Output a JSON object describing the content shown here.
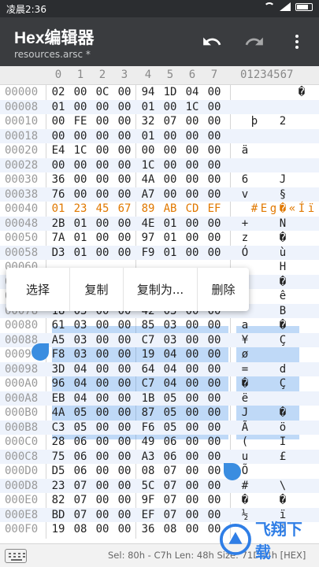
{
  "status_bar": {
    "time": "凌晨2:36"
  },
  "app_bar": {
    "title": "Hex编辑器",
    "subtitle": "resources.arsc *",
    "icons": [
      "undo-icon",
      "redo-icon",
      "more-vert-icon"
    ]
  },
  "header": {
    "columns": [
      "0",
      "1",
      "2",
      "3",
      "4",
      "5",
      "6",
      "7"
    ],
    "ascii": "01234567"
  },
  "rows": [
    {
      "addr": "00000",
      "bytes": [
        "02",
        "00",
        "0C",
        "00",
        "94",
        "1D",
        "04",
        "00"
      ],
      "ascii": [
        "",
        "",
        "",
        "",
        "",
        "",
        "�",
        ""
      ]
    },
    {
      "addr": "00008",
      "bytes": [
        "01",
        "00",
        "00",
        "00",
        "01",
        "00",
        "1C",
        "00"
      ],
      "ascii": [
        "",
        "",
        "",
        "",
        "",
        "",
        "",
        ""
      ]
    },
    {
      "addr": "00010",
      "bytes": [
        "00",
        "FE",
        "00",
        "00",
        "32",
        "07",
        "00",
        "00"
      ],
      "ascii": [
        "",
        "þ",
        "",
        "",
        "2",
        "",
        "",
        ""
      ]
    },
    {
      "addr": "00018",
      "bytes": [
        "00",
        "00",
        "00",
        "00",
        "01",
        "00",
        "00",
        "00"
      ],
      "ascii": [
        "",
        "",
        "",
        "",
        "",
        "",
        "",
        ""
      ]
    },
    {
      "addr": "00020",
      "bytes": [
        "E4",
        "1C",
        "00",
        "00",
        "00",
        "00",
        "00",
        "00"
      ],
      "ascii": [
        "ä",
        "",
        "",
        "",
        "",
        "",
        "",
        ""
      ]
    },
    {
      "addr": "00028",
      "bytes": [
        "00",
        "00",
        "00",
        "00",
        "1C",
        "00",
        "00",
        "00"
      ],
      "ascii": [
        "",
        "",
        "",
        "",
        "",
        "",
        "",
        ""
      ]
    },
    {
      "addr": "00030",
      "bytes": [
        "36",
        "00",
        "00",
        "00",
        "4A",
        "00",
        "00",
        "00"
      ],
      "ascii": [
        "6",
        "",
        "",
        "",
        "J",
        "",
        "",
        ""
      ]
    },
    {
      "addr": "00038",
      "bytes": [
        "76",
        "00",
        "00",
        "00",
        "A7",
        "00",
        "00",
        "00"
      ],
      "ascii": [
        "v",
        "",
        "",
        "",
        "§",
        "",
        "",
        ""
      ]
    },
    {
      "addr": "00040",
      "bytes": [
        "01",
        "23",
        "45",
        "67",
        "89",
        "AB",
        "CD",
        "EF"
      ],
      "ascii": [
        "",
        "#",
        "E",
        "g",
        "�",
        "«",
        "Í",
        "ï"
      ]
    },
    {
      "addr": "00048",
      "bytes": [
        "2B",
        "01",
        "00",
        "00",
        "4E",
        "01",
        "00",
        "00"
      ],
      "ascii": [
        "+",
        "",
        "",
        "",
        "N",
        "",
        "",
        ""
      ]
    },
    {
      "addr": "00050",
      "bytes": [
        "7A",
        "01",
        "00",
        "00",
        "97",
        "01",
        "00",
        "00"
      ],
      "ascii": [
        "z",
        "",
        "",
        "",
        "�",
        "",
        "",
        ""
      ]
    },
    {
      "addr": "00058",
      "bytes": [
        "D3",
        "01",
        "00",
        "00",
        "F9",
        "01",
        "00",
        "00"
      ],
      "ascii": [
        "Ó",
        "",
        "",
        "",
        "ù",
        "",
        "",
        ""
      ]
    },
    {
      "addr": "00060",
      "bytes": [
        "",
        "",
        "",
        "",
        "",
        "",
        "",
        ""
      ],
      "ascii": [
        "",
        "",
        "",
        "",
        "H",
        "",
        "",
        ""
      ]
    },
    {
      "addr": "00068",
      "bytes": [
        "",
        "",
        "",
        "",
        "",
        "",
        "",
        ""
      ],
      "ascii": [
        "",
        "",
        "",
        "",
        "�",
        "",
        "",
        ""
      ]
    },
    {
      "addr": "00070",
      "bytes": [
        "",
        "",
        "",
        "",
        "",
        "",
        "",
        ""
      ],
      "ascii": [
        "",
        "",
        "",
        "",
        "ê",
        "",
        "",
        ""
      ]
    },
    {
      "addr": "00078",
      "bytes": [
        "18",
        "03",
        "00",
        "00",
        "42",
        "03",
        "00",
        "00"
      ],
      "ascii": [
        "",
        "",
        "",
        "",
        "B",
        "",
        "",
        ""
      ]
    },
    {
      "addr": "00080",
      "bytes": [
        "61",
        "03",
        "00",
        "00",
        "85",
        "03",
        "00",
        "00"
      ],
      "ascii": [
        "a",
        "",
        "",
        "",
        "�",
        "",
        "",
        ""
      ]
    },
    {
      "addr": "00088",
      "bytes": [
        "A5",
        "03",
        "00",
        "00",
        "C7",
        "03",
        "00",
        "00"
      ],
      "ascii": [
        "¥",
        "",
        "",
        "",
        "Ç",
        "",
        "",
        ""
      ]
    },
    {
      "addr": "00090",
      "bytes": [
        "F8",
        "03",
        "00",
        "00",
        "19",
        "04",
        "00",
        "00"
      ],
      "ascii": [
        "ø",
        "",
        "",
        "",
        "",
        "",
        "",
        ""
      ]
    },
    {
      "addr": "00098",
      "bytes": [
        "3D",
        "04",
        "00",
        "00",
        "64",
        "04",
        "00",
        "00"
      ],
      "ascii": [
        "=",
        "",
        "",
        "",
        "d",
        "",
        "",
        ""
      ]
    },
    {
      "addr": "000A0",
      "bytes": [
        "96",
        "04",
        "00",
        "00",
        "C7",
        "04",
        "00",
        "00"
      ],
      "ascii": [
        "�",
        "",
        "",
        "",
        "Ç",
        "",
        "",
        ""
      ]
    },
    {
      "addr": "000A8",
      "bytes": [
        "EB",
        "04",
        "00",
        "00",
        "1B",
        "05",
        "00",
        "00"
      ],
      "ascii": [
        "ë",
        "",
        "",
        "",
        "",
        "",
        "",
        ""
      ]
    },
    {
      "addr": "000B0",
      "bytes": [
        "4A",
        "05",
        "00",
        "00",
        "87",
        "05",
        "00",
        "00"
      ],
      "ascii": [
        "J",
        "",
        "",
        "",
        "�",
        "",
        "",
        ""
      ]
    },
    {
      "addr": "000B8",
      "bytes": [
        "C3",
        "05",
        "00",
        "00",
        "F6",
        "05",
        "00",
        "00"
      ],
      "ascii": [
        "Ã",
        "",
        "",
        "",
        "ö",
        "",
        "",
        ""
      ]
    },
    {
      "addr": "000C0",
      "bytes": [
        "28",
        "06",
        "00",
        "00",
        "49",
        "06",
        "00",
        "00"
      ],
      "ascii": [
        "(",
        "",
        "",
        "",
        "I",
        "",
        "",
        ""
      ]
    },
    {
      "addr": "000C8",
      "bytes": [
        "75",
        "06",
        "00",
        "00",
        "A3",
        "06",
        "00",
        "00"
      ],
      "ascii": [
        "u",
        "",
        "",
        "",
        "£",
        "",
        "",
        ""
      ]
    },
    {
      "addr": "000D0",
      "bytes": [
        "D5",
        "06",
        "00",
        "00",
        "08",
        "07",
        "00",
        "00"
      ],
      "ascii": [
        "Õ",
        "",
        "",
        "",
        "",
        "",
        "",
        ""
      ]
    },
    {
      "addr": "000D8",
      "bytes": [
        "23",
        "07",
        "00",
        "00",
        "5C",
        "07",
        "00",
        "00"
      ],
      "ascii": [
        "#",
        "",
        "",
        "",
        "\\",
        "",
        "",
        ""
      ]
    },
    {
      "addr": "000E0",
      "bytes": [
        "82",
        "07",
        "00",
        "00",
        "9F",
        "07",
        "00",
        "00"
      ],
      "ascii": [
        "�",
        "",
        "",
        "",
        "�",
        "",
        "",
        ""
      ]
    },
    {
      "addr": "000E8",
      "bytes": [
        "BD",
        "07",
        "00",
        "00",
        "EF",
        "07",
        "00",
        "00"
      ],
      "ascii": [
        "½",
        "",
        "",
        "",
        "ï",
        "",
        "",
        ""
      ]
    },
    {
      "addr": "000F0",
      "bytes": [
        "19",
        "08",
        "00",
        "00",
        "36",
        "08",
        "00",
        "00"
      ],
      "ascii": [
        "",
        "",
        "",
        "",
        "6",
        "",
        "",
        ""
      ]
    }
  ],
  "highlight_row": "00040",
  "context_menu": {
    "items": [
      "选择",
      "复制",
      "复制为...",
      "删除"
    ]
  },
  "bottom_bar": {
    "selection": "Sel: 80h - C7h  Len: 48h  Size: 71D94h  [HEX]"
  },
  "watermark": {
    "text": "飞翔下载"
  },
  "colors": {
    "accent": "#3a8de0",
    "highlight": "#e07800",
    "app_bar": "#3a3c3f",
    "status_bar": "#2b2d30"
  }
}
